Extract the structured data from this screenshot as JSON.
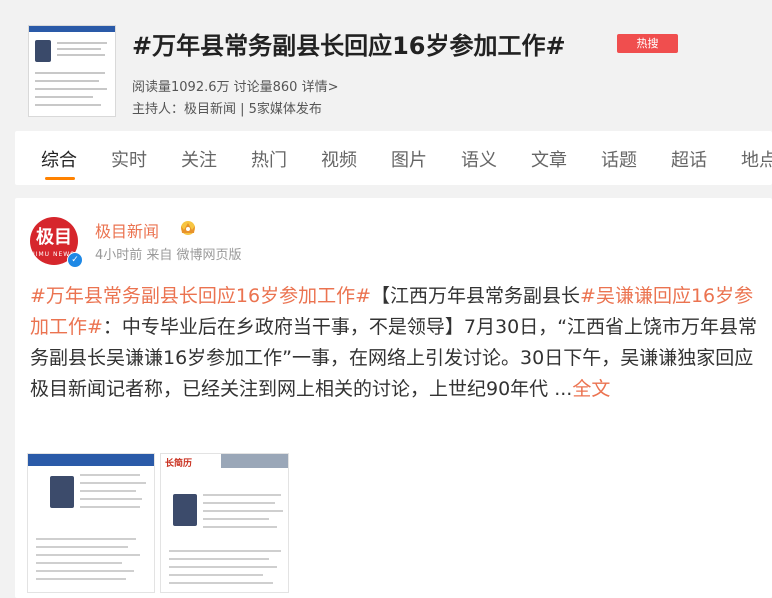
{
  "topic": {
    "title": "#万年县常务副县长回应16岁参加工作#",
    "badge": "热搜",
    "stats": "阅读量1092.6万 讨论量860 详情>",
    "host": "主持人：极目新闻 | 5家媒体发布"
  },
  "tabs": [
    "综合",
    "实时",
    "关注",
    "热门",
    "视频",
    "图片",
    "语义",
    "文章",
    "话题",
    "超话",
    "地点"
  ],
  "post": {
    "author": "极目新闻",
    "avatar_text": "极目",
    "avatar_sub": "JIMU NEWS",
    "meta": "4小时前 来自 微博网页版",
    "tag1": "#万年县常务副县长回应16岁参加工作#",
    "text1": "【江西万年县常务副县长",
    "tag2": "#吴谦谦回应16岁参加工作#",
    "text2": "：中专毕业后在乡政府当干事，不是领导】7月30日，“江西省上饶市万年县常务副县长吴谦谦16岁参加工作”一事，在网络上引发讨论。30日下午，吴谦谦独家回应极目新闻记者称，已经关注到网上相关的讨论，上世纪90年代 ...",
    "more": "全文",
    "image2_label": "长简历"
  },
  "colors": {
    "accent": "#eb7350",
    "badge": "#f04e4e",
    "tab_active": "#ff8200"
  }
}
